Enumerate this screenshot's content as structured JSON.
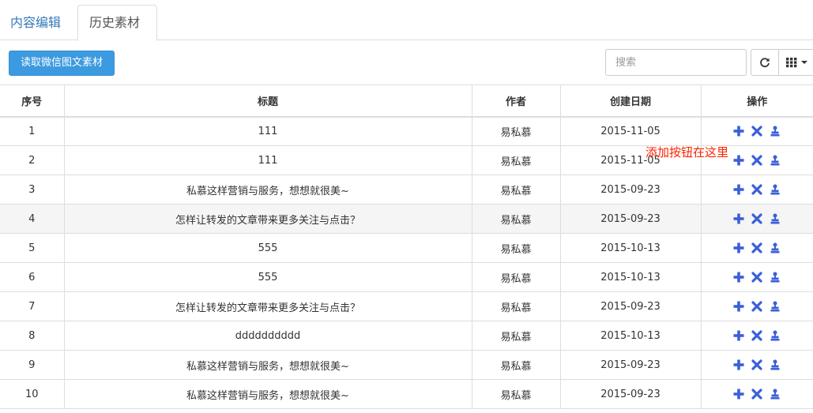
{
  "tabs": [
    {
      "label": "内容编辑"
    },
    {
      "label": "历史素材"
    }
  ],
  "toolbar": {
    "read_button_label": "读取微信图文素材",
    "search_placeholder": "搜索"
  },
  "table": {
    "headers": [
      "序号",
      "标题",
      "作者",
      "创建日期",
      "操作"
    ],
    "rows": [
      {
        "no": "1",
        "title": "111",
        "author": "易私慕",
        "date": "2015-11-05"
      },
      {
        "no": "2",
        "title": "111",
        "author": "易私慕",
        "date": "2015-11-05"
      },
      {
        "no": "3",
        "title": "私慕这样营销与服务，想想就很美~",
        "author": "易私慕",
        "date": "2015-09-23"
      },
      {
        "no": "4",
        "title": "怎样让转发的文章带来更多关注与点击？",
        "author": "易私慕",
        "date": "2015-09-23"
      },
      {
        "no": "5",
        "title": "555",
        "author": "易私慕",
        "date": "2015-10-13"
      },
      {
        "no": "6",
        "title": "555",
        "author": "易私慕",
        "date": "2015-10-13"
      },
      {
        "no": "7",
        "title": "怎样让转发的文章带来更多关注与点击？",
        "author": "易私慕",
        "date": "2015-09-23"
      },
      {
        "no": "8",
        "title": "dddddddddd",
        "author": "易私慕",
        "date": "2015-10-13"
      },
      {
        "no": "9",
        "title": "私慕这样营销与服务，想想就很美~",
        "author": "易私慕",
        "date": "2015-09-23"
      },
      {
        "no": "10",
        "title": "私慕这样营销与服务，想想就很美~",
        "author": "易私慕",
        "date": "2015-09-23"
      }
    ],
    "highlighted_row": 4,
    "row_action_icons": [
      "plus-icon",
      "close-icon",
      "stamp-icon"
    ]
  },
  "annotation": {
    "text": "添加按钮在这里"
  },
  "colors": {
    "accent": "#3c9ae0",
    "link": "#337ab7",
    "action_icon": "#3b5fd9",
    "annotation": "#ff2200",
    "highlight_row": "#f5f5f5"
  }
}
